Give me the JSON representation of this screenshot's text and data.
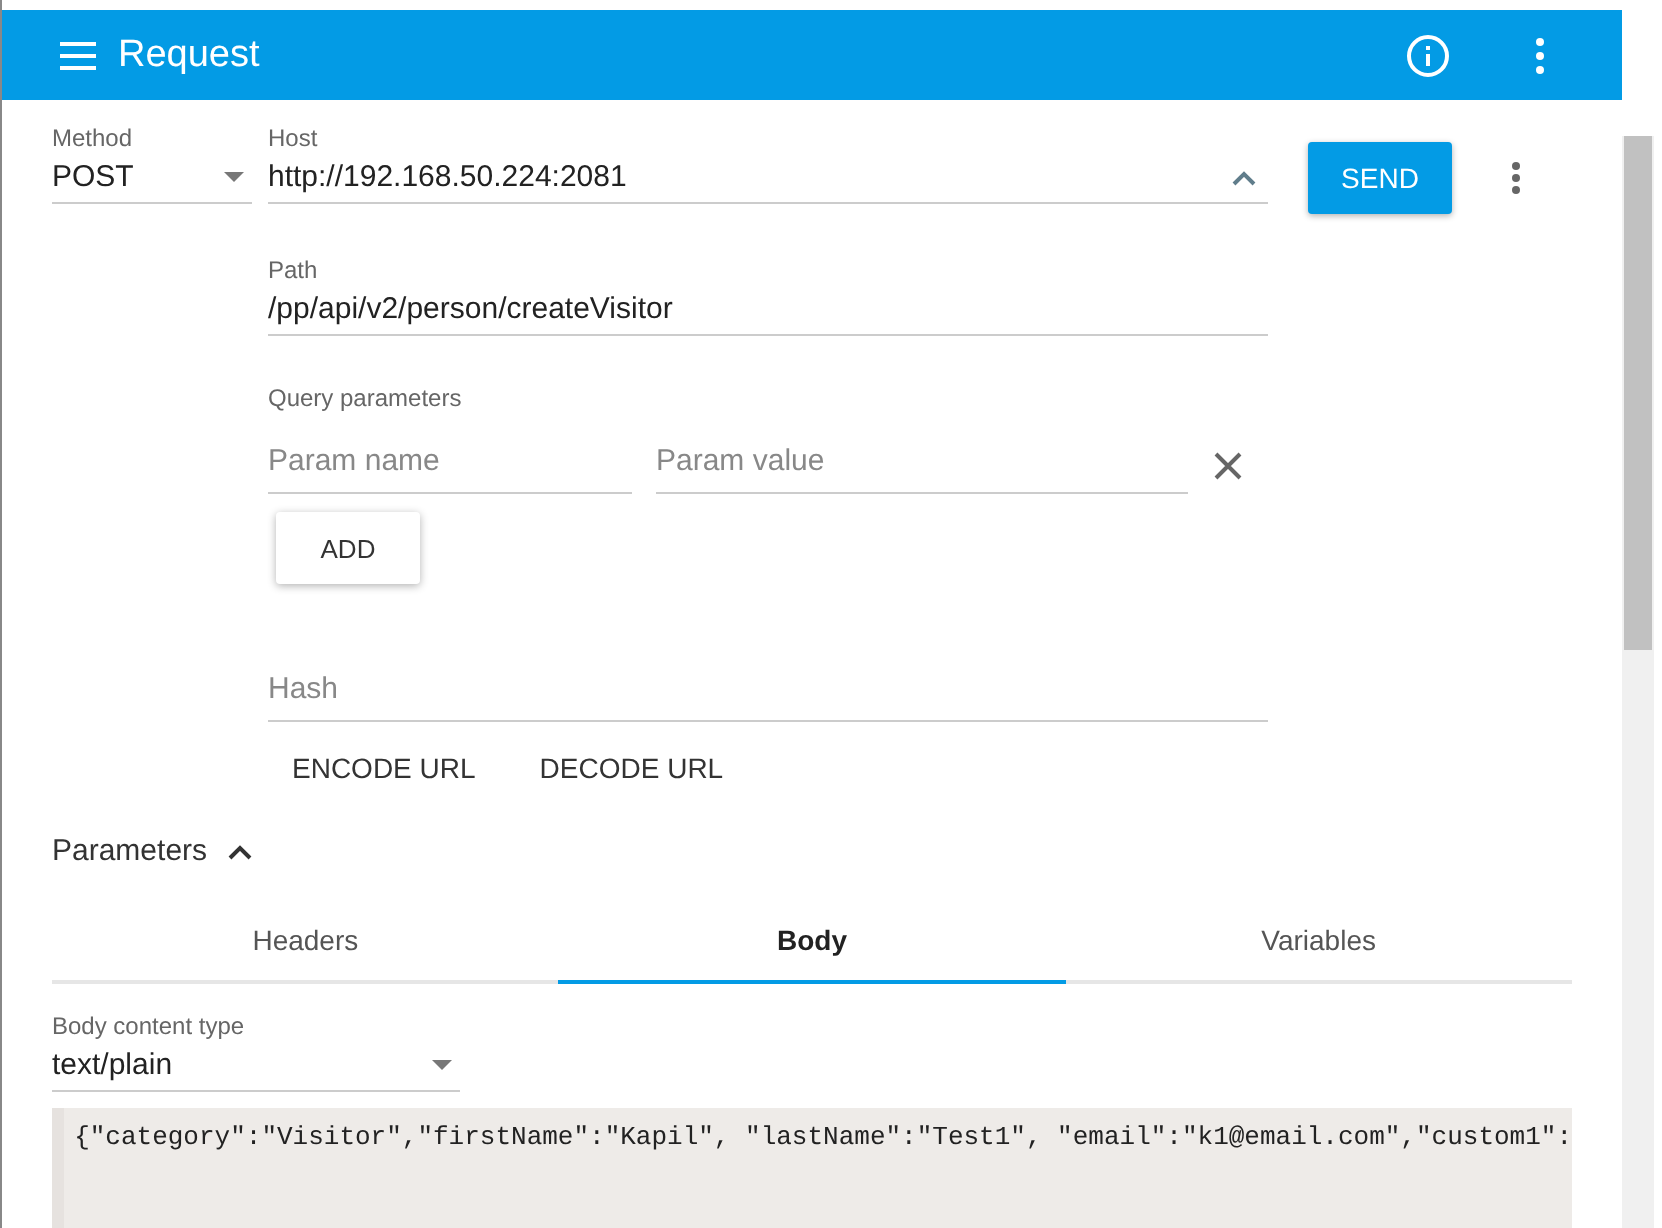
{
  "toolbar": {
    "title": "Request"
  },
  "request": {
    "method": {
      "label": "Method",
      "value": "POST"
    },
    "host": {
      "label": "Host",
      "value": "http://192.168.50.224:2081"
    },
    "send": "SEND",
    "path": {
      "label": "Path",
      "value": "/pp/api/v2/person/createVisitor"
    },
    "query": {
      "label": "Query parameters",
      "name_placeholder": "Param name",
      "value_placeholder": "Param value",
      "add": "ADD"
    },
    "hash": {
      "placeholder": "Hash"
    },
    "url_buttons": [
      "ENCODE URL",
      "DECODE URL"
    ]
  },
  "parameters": {
    "title": "Parameters",
    "expanded": true,
    "tabs": [
      {
        "label": "Headers",
        "selected": false
      },
      {
        "label": "Body",
        "selected": true
      },
      {
        "label": "Variables",
        "selected": false
      }
    ],
    "body_content_type": {
      "label": "Body content type",
      "value": "text/plain"
    },
    "body": "{\"category\":\"Visitor\",\"firstName\":\"Kapil\", \"lastName\":\"Test1\", \"email\":\"k1@email.com\",\"custom1\":"
  }
}
